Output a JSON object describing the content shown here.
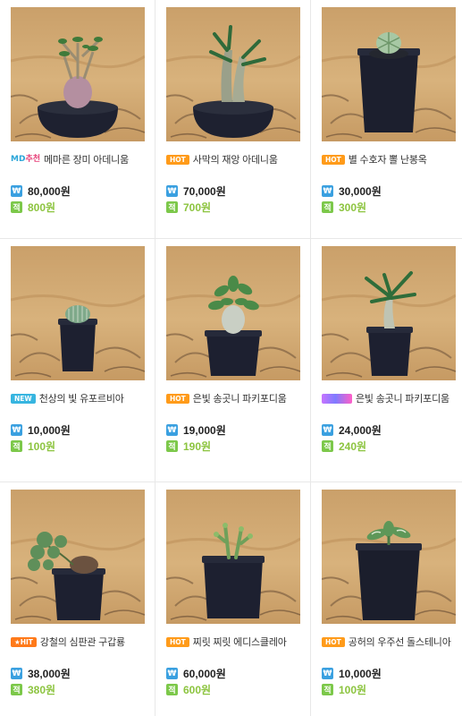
{
  "products": [
    {
      "badge": "MD추천",
      "badge_type": "md",
      "name": "메마른 장미 아데니움",
      "price": "80,000원",
      "point": "800원",
      "won_icon": "₩",
      "point_icon": "적"
    },
    {
      "badge": "HOT",
      "badge_type": "hot",
      "name": "사막의 재앙 아데니움",
      "price": "70,000원",
      "point": "700원",
      "won_icon": "₩",
      "point_icon": "적"
    },
    {
      "badge": "HOT",
      "badge_type": "hot",
      "name": "별 수호자 뽈 난봉옥",
      "price": "30,000원",
      "point": "300원",
      "won_icon": "₩",
      "point_icon": "적"
    },
    {
      "badge": "NEW",
      "badge_type": "new",
      "name": "천상의 빛 유포르비아",
      "price": "10,000원",
      "point": "100원",
      "won_icon": "₩",
      "point_icon": "적"
    },
    {
      "badge": "HOT",
      "badge_type": "hot",
      "name": "은빛 송곳니 파키포디움",
      "price": "19,000원",
      "point": "190원",
      "won_icon": "₩",
      "point_icon": "적"
    },
    {
      "badge": "",
      "badge_type": "grad",
      "name": "은빛 송곳니 파키포디움",
      "price": "24,000원",
      "point": "240원",
      "won_icon": "₩",
      "point_icon": "적"
    },
    {
      "badge": "★HIT",
      "badge_type": "hit",
      "name": "강철의 심판관 구갑룡",
      "price": "38,000원",
      "point": "380원",
      "won_icon": "₩",
      "point_icon": "적"
    },
    {
      "badge": "HOT",
      "badge_type": "hot",
      "name": "찌릿 찌릿 에디스클레아",
      "price": "60,000원",
      "point": "600원",
      "won_icon": "₩",
      "point_icon": "적"
    },
    {
      "badge": "HOT",
      "badge_type": "hot",
      "name": "공허의 우주선 돌스테니아",
      "price": "10,000원",
      "point": "100원",
      "won_icon": "₩",
      "point_icon": "적"
    }
  ],
  "colors": {
    "won_icon": "#3aa0e0",
    "point_icon": "#7cc84a",
    "point_text": "#8cc43f",
    "hot_badge": "#ff9b1a",
    "new_badge": "#37b5e0"
  },
  "icons": {
    "product_image": "potted-succulent-photo",
    "price_icon": "won-icon",
    "point_icon": "point-icon"
  }
}
